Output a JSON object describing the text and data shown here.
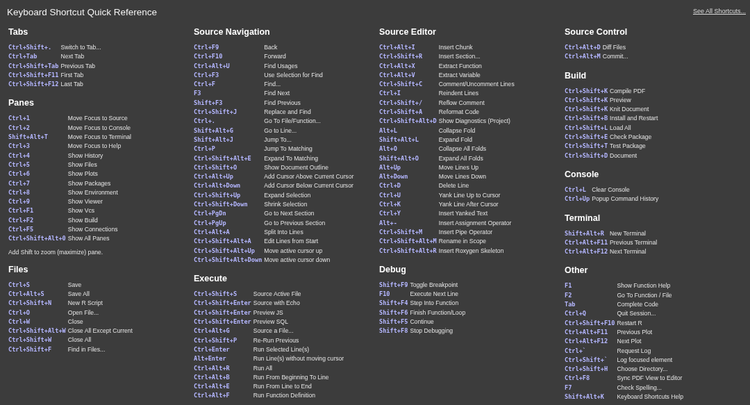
{
  "title": "Keyboard Shortcut Quick Reference",
  "see_all_link": "See All Shortcuts...",
  "columns": [
    {
      "sections": [
        {
          "title": "Tabs",
          "shortcuts": [
            {
              "keys": "Ctrl+Shift+.",
              "action": "Switch to Tab..."
            },
            {
              "keys": "Ctrl+Tab",
              "action": "Next Tab"
            },
            {
              "keys": "Ctrl+Shift+Tab",
              "action": "Previous Tab"
            },
            {
              "keys": "Ctrl+Shift+F11",
              "action": "First Tab"
            },
            {
              "keys": "Ctrl+Shift+F12",
              "action": "Last Tab"
            }
          ]
        },
        {
          "title": "Panes",
          "note": "Add Shift to zoom (maximize) pane.",
          "shortcuts": [
            {
              "keys": "Ctrl+1",
              "action": "Move Focus to Source"
            },
            {
              "keys": "Ctrl+2",
              "action": "Move Focus to Console"
            },
            {
              "keys": "Shift+Alt+T",
              "action": "Move Focus to Terminal"
            },
            {
              "keys": "Ctrl+3",
              "action": "Move Focus to Help"
            },
            {
              "keys": "Ctrl+4",
              "action": "Show History"
            },
            {
              "keys": "Ctrl+5",
              "action": "Show Files"
            },
            {
              "keys": "Ctrl+6",
              "action": "Show Plots"
            },
            {
              "keys": "Ctrl+7",
              "action": "Show Packages"
            },
            {
              "keys": "Ctrl+8",
              "action": "Show Environment"
            },
            {
              "keys": "Ctrl+9",
              "action": "Show Viewer"
            },
            {
              "keys": "Ctrl+F1",
              "action": "Show Vcs"
            },
            {
              "keys": "Ctrl+F2",
              "action": "Show Build"
            },
            {
              "keys": "Ctrl+F5",
              "action": "Show Connections"
            },
            {
              "keys": "Ctrl+Shift+Alt+0",
              "action": "Show All Panes"
            }
          ]
        },
        {
          "title": "Files",
          "shortcuts": [
            {
              "keys": "Ctrl+S",
              "action": "Save"
            },
            {
              "keys": "Ctrl+Alt+S",
              "action": "Save All"
            },
            {
              "keys": "Ctrl+Shift+N",
              "action": "New R Script"
            },
            {
              "keys": "Ctrl+O",
              "action": "Open File..."
            },
            {
              "keys": "Ctrl+W",
              "action": "Close"
            },
            {
              "keys": "Ctrl+Shift+Alt+W",
              "action": "Close All Except Current"
            },
            {
              "keys": "Ctrl+Shift+W",
              "action": "Close All"
            },
            {
              "keys": "Ctrl+Shift+F",
              "action": "Find in Files..."
            }
          ]
        }
      ]
    },
    {
      "sections": [
        {
          "title": "Source Navigation",
          "shortcuts": [
            {
              "keys": "Ctrl+F9",
              "action": "Back"
            },
            {
              "keys": "Ctrl+F10",
              "action": "Forward"
            },
            {
              "keys": "Ctrl+Alt+U",
              "action": "Find Usages"
            },
            {
              "keys": "Ctrl+F3",
              "action": "Use Selection for Find"
            },
            {
              "keys": "Ctrl+F",
              "action": "Find..."
            },
            {
              "keys": "F3",
              "action": "Find Next"
            },
            {
              "keys": "Shift+F3",
              "action": "Find Previous"
            },
            {
              "keys": "Ctrl+Shift+J",
              "action": "Replace and Find"
            },
            {
              "keys": "Ctrl+.",
              "action": "Go To File/Function..."
            },
            {
              "keys": "Shift+Alt+G",
              "action": "Go to Line..."
            },
            {
              "keys": "Shift+Alt+J",
              "action": "Jump To..."
            },
            {
              "keys": "Ctrl+P",
              "action": "Jump To Matching"
            },
            {
              "keys": "Ctrl+Shift+Alt+E",
              "action": "Expand To Matching"
            },
            {
              "keys": "Ctrl+Shift+O",
              "action": "Show Document Outline"
            },
            {
              "keys": "Ctrl+Alt+Up",
              "action": "Add Cursor Above Current Cursor"
            },
            {
              "keys": "Ctrl+Alt+Down",
              "action": "Add Cursor Below Current Cursor"
            },
            {
              "keys": "Ctrl+Shift+Up",
              "action": "Expand Selection"
            },
            {
              "keys": "Ctrl+Shift+Down",
              "action": "Shrink Selection"
            },
            {
              "keys": "Ctrl+PgDn",
              "action": "Go to Next Section"
            },
            {
              "keys": "Ctrl+PgUp",
              "action": "Go to Previous Section"
            },
            {
              "keys": "Ctrl+Alt+A",
              "action": "Split Into Lines"
            },
            {
              "keys": "Ctrl+Shift+Alt+A",
              "action": "Edit Lines from Start"
            },
            {
              "keys": "Ctrl+Shift+Alt+Up",
              "action": "Move active cursor up"
            },
            {
              "keys": "Ctrl+Shift+Alt+Down",
              "action": "Move active cursor down"
            }
          ]
        },
        {
          "title": "Execute",
          "shortcuts": [
            {
              "keys": "Ctrl+Shift+S",
              "action": "Source Active File"
            },
            {
              "keys": "Ctrl+Shift+Enter",
              "action": "Source with Echo"
            },
            {
              "keys": "Ctrl+Shift+Enter",
              "action": "Preview JS"
            },
            {
              "keys": "Ctrl+Shift+Enter",
              "action": "Preview SQL"
            },
            {
              "keys": "Ctrl+Alt+G",
              "action": "Source a File..."
            },
            {
              "keys": "Ctrl+Shift+P",
              "action": "Re-Run Previous"
            },
            {
              "keys": "Ctrl+Enter",
              "action": "Run Selected Line(s)"
            },
            {
              "keys": "Alt+Enter",
              "action": "Run Line(s) without moving cursor"
            },
            {
              "keys": "Ctrl+Alt+R",
              "action": "Run All"
            },
            {
              "keys": "Ctrl+Alt+B",
              "action": "Run From Beginning To Line"
            },
            {
              "keys": "Ctrl+Alt+E",
              "action": "Run From Line to End"
            },
            {
              "keys": "Ctrl+Alt+F",
              "action": "Run Function Definition"
            }
          ]
        }
      ]
    },
    {
      "sections": [
        {
          "title": "Source Editor",
          "shortcuts": [
            {
              "keys": "Ctrl+Alt+I",
              "action": "Insert Chunk"
            },
            {
              "keys": "Ctrl+Shift+R",
              "action": "Insert Section..."
            },
            {
              "keys": "Ctrl+Alt+X",
              "action": "Extract Function"
            },
            {
              "keys": "Ctrl+Alt+V",
              "action": "Extract Variable"
            },
            {
              "keys": "Ctrl+Shift+C",
              "action": "Comment/Uncomment Lines"
            },
            {
              "keys": "Ctrl+I",
              "action": "Reindent Lines"
            },
            {
              "keys": "Ctrl+Shift+/",
              "action": "Reflow Comment"
            },
            {
              "keys": "Ctrl+Shift+A",
              "action": "Reformat Code"
            },
            {
              "keys": "Ctrl+Shift+Alt+D",
              "action": "Show Diagnostics (Project)"
            },
            {
              "keys": "Alt+L",
              "action": "Collapse Fold"
            },
            {
              "keys": "Shift+Alt+L",
              "action": "Expand Fold"
            },
            {
              "keys": "Alt+O",
              "action": "Collapse All Folds"
            },
            {
              "keys": "Shift+Alt+O",
              "action": "Expand All Folds"
            },
            {
              "keys": "Alt+Up",
              "action": "Move Lines Up"
            },
            {
              "keys": "Alt+Down",
              "action": "Move Lines Down"
            },
            {
              "keys": "Ctrl+D",
              "action": "Delete Line"
            },
            {
              "keys": "Ctrl+U",
              "action": "Yank Line Up to Cursor"
            },
            {
              "keys": "Ctrl+K",
              "action": "Yank Line After Cursor"
            },
            {
              "keys": "Ctrl+Y",
              "action": "Insert Yanked Text"
            },
            {
              "keys": "Alt+-",
              "action": "Insert Assignment Operator"
            },
            {
              "keys": "Ctrl+Shift+M",
              "action": "Insert Pipe Operator"
            },
            {
              "keys": "Ctrl+Shift+Alt+M",
              "action": "Rename in Scope"
            },
            {
              "keys": "Ctrl+Shift+Alt+R",
              "action": "Insert Roxygen Skeleton"
            }
          ]
        },
        {
          "title": "Debug",
          "shortcuts": [
            {
              "keys": "Shift+F9",
              "action": "Toggle Breakpoint"
            },
            {
              "keys": "F10",
              "action": "Execute Next Line"
            },
            {
              "keys": "Shift+F4",
              "action": "Step Into Function"
            },
            {
              "keys": "Shift+F6",
              "action": "Finish Function/Loop"
            },
            {
              "keys": "Shift+F5",
              "action": "Continue"
            },
            {
              "keys": "Shift+F8",
              "action": "Stop Debugging"
            }
          ]
        }
      ]
    },
    {
      "sections": [
        {
          "title": "Source Control",
          "shortcuts": [
            {
              "keys": "Ctrl+Alt+D",
              "action": "Diff Files"
            },
            {
              "keys": "Ctrl+Alt+M",
              "action": "Commit..."
            }
          ]
        },
        {
          "title": "Build",
          "shortcuts": [
            {
              "keys": "Ctrl+Shift+K",
              "action": "Compile PDF"
            },
            {
              "keys": "Ctrl+Shift+K",
              "action": "Preview"
            },
            {
              "keys": "Ctrl+Shift+K",
              "action": "Knit Document"
            },
            {
              "keys": "Ctrl+Shift+B",
              "action": "Install and Restart"
            },
            {
              "keys": "Ctrl+Shift+L",
              "action": "Load All"
            },
            {
              "keys": "Ctrl+Shift+E",
              "action": "Check Package"
            },
            {
              "keys": "Ctrl+Shift+T",
              "action": "Test Package"
            },
            {
              "keys": "Ctrl+Shift+D",
              "action": "Document"
            }
          ]
        },
        {
          "title": "Console",
          "shortcuts": [
            {
              "keys": "Ctrl+L",
              "action": "Clear Console"
            },
            {
              "keys": "Ctrl+Up",
              "action": "Popup Command History"
            }
          ]
        },
        {
          "title": "Terminal",
          "shortcuts": [
            {
              "keys": "Shift+Alt+R",
              "action": "New Terminal"
            },
            {
              "keys": "Ctrl+Alt+F11",
              "action": "Previous Terminal"
            },
            {
              "keys": "Ctrl+Alt+F12",
              "action": "Next Terminal"
            }
          ]
        },
        {
          "title": "Other",
          "shortcuts": [
            {
              "keys": "F1",
              "action": "Show Function Help"
            },
            {
              "keys": "F2",
              "action": "Go To Function / File"
            },
            {
              "keys": "Tab",
              "action": "Complete Code"
            },
            {
              "keys": "Ctrl+Q",
              "action": "Quit Session..."
            },
            {
              "keys": "Ctrl+Shift+F10",
              "action": "Restart R"
            },
            {
              "keys": "Ctrl+Alt+F11",
              "action": "Previous Plot"
            },
            {
              "keys": "Ctrl+Alt+F12",
              "action": "Next Plot"
            },
            {
              "keys": "Ctrl+`",
              "action": "Request Log"
            },
            {
              "keys": "Ctrl+Shift+`",
              "action": "Log focused element"
            },
            {
              "keys": "Ctrl+Shift+H",
              "action": "Choose Directory..."
            },
            {
              "keys": "Ctrl+F8",
              "action": "Sync PDF View to Editor"
            },
            {
              "keys": "F7",
              "action": "Check Spelling..."
            },
            {
              "keys": "Shift+Alt+K",
              "action": "Keyboard Shortcuts Help"
            }
          ]
        }
      ]
    }
  ]
}
